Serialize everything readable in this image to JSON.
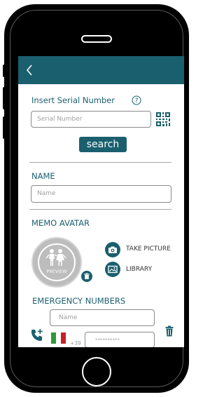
{
  "nav": {
    "back_icon": "chevron-left-icon"
  },
  "serial": {
    "label": "Insert Serial Number",
    "help_icon": "question-mark-icon",
    "placeholder": "Serial Number",
    "qr_icon": "qr-code-icon",
    "search_label": "search"
  },
  "name_section": {
    "title": "NAME",
    "placeholder": "Name"
  },
  "avatar_section": {
    "title": "MEMO AVATAR",
    "preview_label": "PREVIEW",
    "take_picture_label": "TAKE PICTURE",
    "library_label": "LIBRARY"
  },
  "emergency": {
    "title": "EMERGENCY NUMBERS",
    "name_placeholder": "Name",
    "country_code": "+39",
    "phone_placeholder": "**********"
  },
  "colors": {
    "accent": "#1a5f6e",
    "flag_green": "#2e9a3a",
    "flag_red": "#c8202a"
  }
}
